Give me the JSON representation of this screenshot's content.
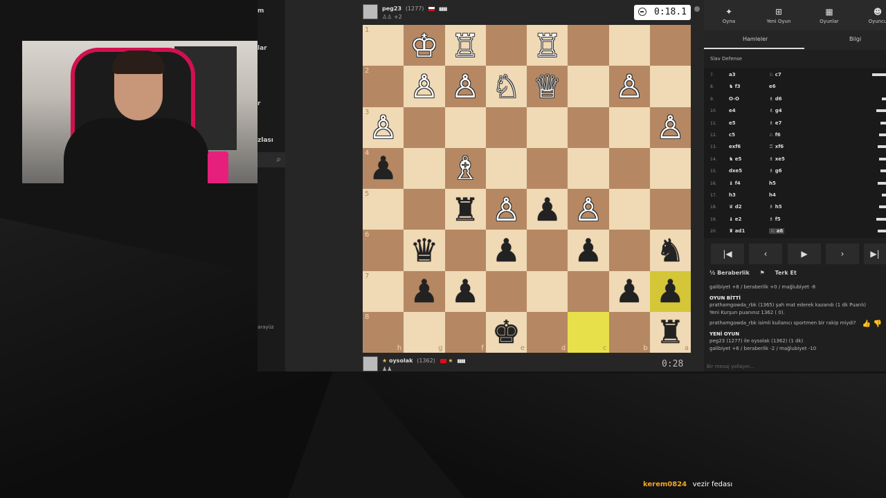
{
  "site_sidebar": {
    "labels": [
      "m",
      "lar",
      "r",
      "zlası",
      "arayüz"
    ]
  },
  "top_player": {
    "name": "peg23",
    "rating": "(1277)",
    "captured": "+2",
    "clock": "0:18.1"
  },
  "bottom_player": {
    "name": "oysolak",
    "rating": "(1362)",
    "clock": "0:28"
  },
  "board": {
    "ranks": [
      "1",
      "2",
      "3",
      "4",
      "5",
      "6",
      "7",
      "8"
    ],
    "files": [
      "h",
      "g",
      "f",
      "e",
      "d",
      "c",
      "b",
      "a"
    ],
    "rows": [
      [
        "",
        "wK",
        "wR",
        "",
        "wR",
        "",
        "",
        ""
      ],
      [
        "",
        "wP",
        "wP",
        "wN",
        "wQ",
        "",
        "wP",
        ""
      ],
      [
        "wP",
        "",
        "",
        "",
        "",
        "",
        "",
        "wP"
      ],
      [
        "bP",
        "",
        "wB",
        "",
        "",
        "",
        "",
        ""
      ],
      [
        "",
        "",
        "bR",
        "wP",
        "bP",
        "wP",
        "",
        ""
      ],
      [
        "",
        "bQ",
        "",
        "bP",
        "",
        "bP",
        "",
        "bN"
      ],
      [
        "",
        "bP",
        "bP",
        "",
        "",
        "",
        "bP",
        "bP"
      ],
      [
        "",
        "",
        "",
        "bK",
        "",
        "",
        "",
        "bR"
      ]
    ],
    "highlighted": [
      "6-7",
      "7-5"
    ]
  },
  "right_panel": {
    "top_tabs": [
      {
        "label": "Oyna",
        "icon": "play-icon"
      },
      {
        "label": "Yeni Oyun",
        "icon": "plus-icon"
      },
      {
        "label": "Oyunlar",
        "icon": "board-icon"
      },
      {
        "label": "Oyuncu",
        "icon": "user-icon"
      }
    ],
    "sub_tabs": [
      "Hamleler",
      "Bilgi"
    ],
    "opening": "Slav Defense",
    "moves": [
      {
        "n": "7.",
        "w": "a3",
        "b": "♘ c7"
      },
      {
        "n": "8.",
        "w": "♞ f3",
        "b": "e6"
      },
      {
        "n": "9.",
        "w": "O-O",
        "b": "♗ d6"
      },
      {
        "n": "10.",
        "w": "e4",
        "b": "♗ g4"
      },
      {
        "n": "11.",
        "w": "e5",
        "b": "♗ e7"
      },
      {
        "n": "12.",
        "w": "c5",
        "b": "♘ f6"
      },
      {
        "n": "13.",
        "w": "exf6",
        "b": "♖ xf6"
      },
      {
        "n": "14.",
        "w": "♞ e5",
        "b": "♗ xe5"
      },
      {
        "n": "15.",
        "w": "dxe5",
        "b": "♗ g6"
      },
      {
        "n": "16.",
        "w": "♝ f4",
        "b": "h5"
      },
      {
        "n": "17.",
        "w": "h3",
        "b": "h4"
      },
      {
        "n": "18.",
        "w": "♛ d2",
        "b": "♗ h5"
      },
      {
        "n": "19.",
        "w": "♝ e2",
        "b": "♗ f5"
      },
      {
        "n": "20.",
        "w": "♜ ad1",
        "b": "♘ a6"
      }
    ],
    "nav": [
      "first",
      "prev",
      "play",
      "next",
      "last"
    ],
    "actions": [
      "½ Beraberlik",
      "Terk Et"
    ],
    "log": {
      "l1": "galibiyet +8 / beraberlik +0 / mağlubiyet -8",
      "l2": "OYUN BİTTİ",
      "l3": "prathamgowda_rbk (1365) şah mat ederek kazandı (1 dk Puanlı)",
      "l4": "Yeni Kurşun puanınız 1362 ( 0).",
      "l5": "prathamgowda_rbk isimli kullanıcı sportmen bir rakip miydi?",
      "l6": "YENİ OYUN",
      "l7": "peg23 (1277) ile oysolak (1362) (1 dk)",
      "l8": "galibiyet +6 / beraberlik -2 / mağlubiyet -10"
    },
    "chat_placeholder": "Bir mesaj yollayın..."
  },
  "stream_chat": {
    "user": "kerem0824",
    "message": "vezir fedası"
  },
  "colors": {
    "light_square": "#f0d9b5",
    "dark_square": "#b58863",
    "highlight": "#e8e04a"
  }
}
